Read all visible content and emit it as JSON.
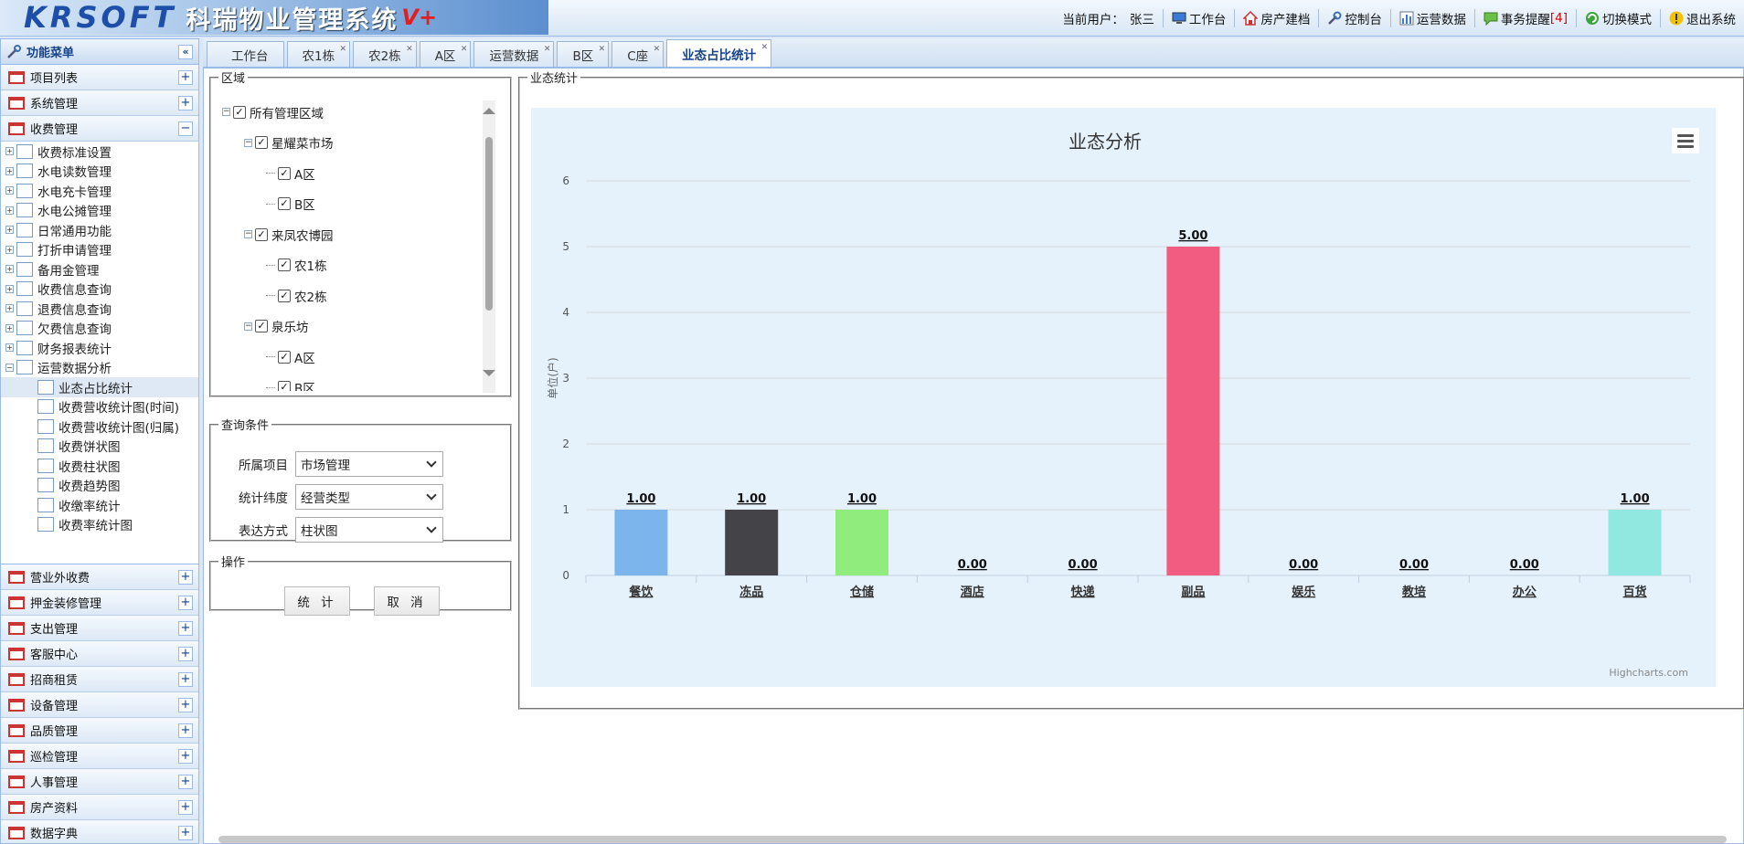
{
  "header": {
    "brand": "KRSOFT",
    "title": "科瑞物业管理系统",
    "version": "V+",
    "user_label": "当前用户：",
    "user_name": "张三",
    "toolbar": [
      {
        "label": "工作台",
        "icon": "monitor-icon"
      },
      {
        "label": "房产建档",
        "icon": "house-icon"
      },
      {
        "label": "控制台",
        "icon": "tools-icon"
      },
      {
        "label": "运营数据",
        "icon": "bar-chart-icon"
      },
      {
        "label": "事务提醒",
        "icon": "message-icon",
        "badge": "[4]"
      },
      {
        "label": "切换模式",
        "icon": "switch-icon"
      },
      {
        "label": "退出系统",
        "icon": "warning-icon"
      }
    ]
  },
  "sidebar": {
    "title": "功能菜单",
    "top_groups": [
      {
        "label": "项目列表",
        "toggle": "+"
      },
      {
        "label": "系统管理",
        "toggle": "+"
      },
      {
        "label": "收费管理",
        "toggle": "−"
      }
    ],
    "tree": [
      {
        "label": "收费标准设置"
      },
      {
        "label": "水电读数管理"
      },
      {
        "label": "水电充卡管理"
      },
      {
        "label": "水电公摊管理"
      },
      {
        "label": "日常通用功能"
      },
      {
        "label": "打折申请管理"
      },
      {
        "label": "备用金管理"
      },
      {
        "label": "收费信息查询"
      },
      {
        "label": "退费信息查询"
      },
      {
        "label": "欠费信息查询"
      },
      {
        "label": "财务报表统计"
      },
      {
        "label": "运营数据分析",
        "expanded": true
      }
    ],
    "tree_children": [
      {
        "label": "业态占比统计",
        "selected": true
      },
      {
        "label": "收费营收统计图(时间)"
      },
      {
        "label": "收费营收统计图(归属)"
      },
      {
        "label": "收费饼状图"
      },
      {
        "label": "收费柱状图"
      },
      {
        "label": "收费趋势图"
      },
      {
        "label": "收缴率统计"
      },
      {
        "label": "收费率统计图"
      }
    ],
    "bottom_groups": [
      {
        "label": "营业外收费"
      },
      {
        "label": "押金装修管理"
      },
      {
        "label": "支出管理"
      },
      {
        "label": "客服中心"
      },
      {
        "label": "招商租赁"
      },
      {
        "label": "设备管理"
      },
      {
        "label": "品质管理"
      },
      {
        "label": "巡检管理"
      },
      {
        "label": "人事管理"
      },
      {
        "label": "房产资料"
      },
      {
        "label": "数据字典"
      }
    ]
  },
  "tabs": [
    {
      "label": "工作台",
      "closable": false
    },
    {
      "label": "农1栋",
      "closable": true
    },
    {
      "label": "农2栋",
      "closable": true
    },
    {
      "label": "A区",
      "closable": true
    },
    {
      "label": "运营数据",
      "closable": true
    },
    {
      "label": "B区",
      "closable": true
    },
    {
      "label": "C座",
      "closable": true
    },
    {
      "label": "业态占比统计",
      "closable": true,
      "active": true
    }
  ],
  "area_panel": {
    "legend": "区域",
    "nodes": [
      {
        "label": "所有管理区域",
        "level": 0,
        "toggle": "−",
        "checked": true
      },
      {
        "label": "星耀菜市场",
        "level": 1,
        "toggle": "−",
        "checked": true
      },
      {
        "label": "A区",
        "level": 2,
        "checked": true
      },
      {
        "label": "B区",
        "level": 2,
        "checked": true
      },
      {
        "label": "来凤农博园",
        "level": 1,
        "toggle": "−",
        "checked": true
      },
      {
        "label": "农1栋",
        "level": 2,
        "checked": true
      },
      {
        "label": "农2栋",
        "level": 2,
        "checked": true
      },
      {
        "label": "泉乐坊",
        "level": 1,
        "toggle": "−",
        "checked": true
      },
      {
        "label": "A区",
        "level": 2,
        "checked": true
      },
      {
        "label": "B区",
        "level": 2,
        "checked": true
      }
    ]
  },
  "query_panel": {
    "legend": "查询条件",
    "fields": [
      {
        "label": "所属项目",
        "value": "市场管理"
      },
      {
        "label": "统计纬度",
        "value": "经营类型"
      },
      {
        "label": "表达方式",
        "value": "柱状图"
      }
    ]
  },
  "ops_panel": {
    "legend": "操作",
    "stat_button": "统 计",
    "cancel_button": "取 消"
  },
  "stats_panel": {
    "legend": "业态统计",
    "credits": "Highcharts.com"
  },
  "chart_data": {
    "type": "bar",
    "title": "业态分析",
    "ylabel": "单位(户)",
    "xlabel": "",
    "ylim": [
      0,
      6
    ],
    "yticks": [
      0,
      1,
      2,
      3,
      4,
      5,
      6
    ],
    "categories": [
      "餐饮",
      "冻品",
      "仓储",
      "酒店",
      "快递",
      "副品",
      "娱乐",
      "教培",
      "办公",
      "百货"
    ],
    "values": [
      1,
      1,
      1,
      0,
      0,
      5,
      0,
      0,
      0,
      1
    ],
    "data_labels": [
      "1.00",
      "1.00",
      "1.00",
      "0.00",
      "0.00",
      "5.00",
      "0.00",
      "0.00",
      "0.00",
      "1.00"
    ],
    "colors": [
      "#7cb5ec",
      "#434348",
      "#90ed7d",
      "#f7a35c",
      "#8085e9",
      "#f15c80",
      "#e4d354",
      "#2b908f",
      "#f45b5b",
      "#91e8e1"
    ],
    "grid": true,
    "legend": "none"
  }
}
